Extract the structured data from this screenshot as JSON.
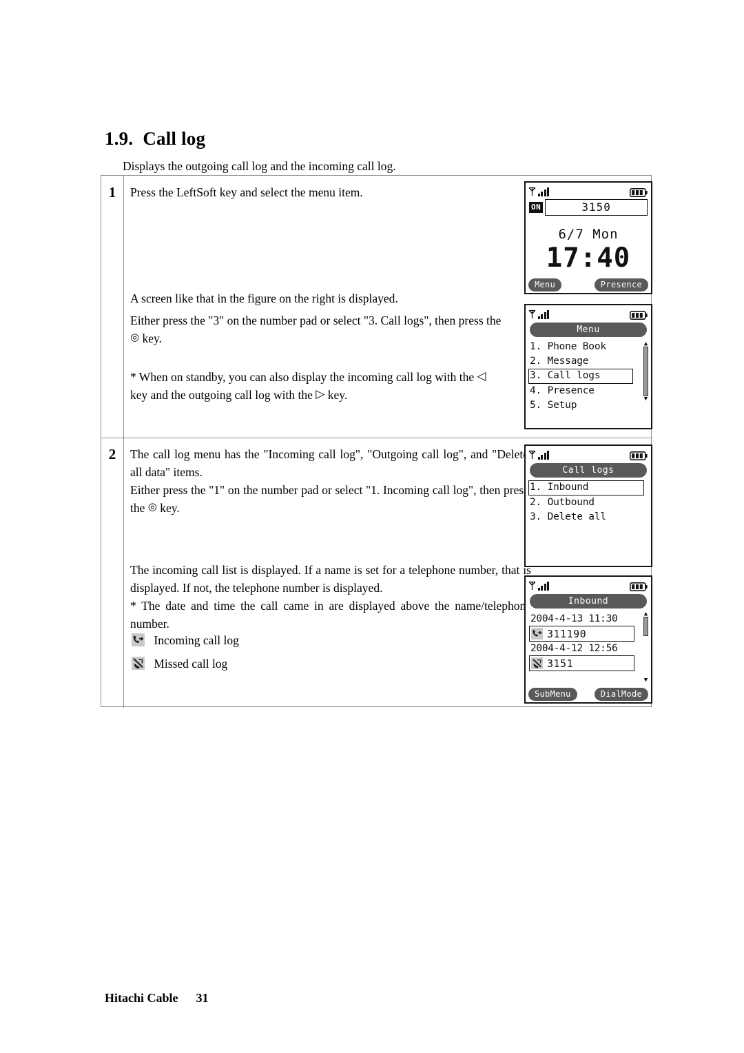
{
  "heading": {
    "number": "1.9.",
    "title": "Call log"
  },
  "intro": "Displays the outgoing call log and the incoming call log.",
  "steps": [
    {
      "number": "1",
      "paragraphs": [
        "Press the LeftSoft key and select the menu item.",
        "A screen like that in the figure on the right is displayed.",
        "Either press the \"3\" on the number pad or select \"3. Call logs\", then press the",
        "key.",
        "* When on standby, you can also display the incoming call log with the",
        "key and the outgoing call log with the",
        "key."
      ]
    },
    {
      "number": "2",
      "paragraphs": [
        "The call log menu has the \"Incoming call log\", \"Outgoing call log\", and \"Delete all data\" items.",
        "Either press the \"1\" on the number pad or select \"1. Incoming call log\", then press the",
        "key.",
        "The incoming call list is displayed. If a name is set for a telephone number, that is displayed.  If not, the telephone number is displayed.",
        "* The date and time the call came in are displayed above the name/telephone number."
      ],
      "legend": [
        {
          "icon": "incoming-call-icon",
          "label": "Incoming call log"
        },
        {
          "icon": "missed-call-icon",
          "label": "Missed call log"
        }
      ]
    }
  ],
  "key_glyphs": {
    "center": "◎",
    "left": "◁",
    "right": "▷"
  },
  "phones": {
    "standby": {
      "name": "standby-screen",
      "on_badge": "ON",
      "number": "3150",
      "date": "6/7 Mon",
      "time": "17:40",
      "softkey_left": "Menu",
      "softkey_right": "Presence"
    },
    "menu": {
      "name": "menu-screen",
      "title": "Menu",
      "items": [
        {
          "label": "1. Phone Book",
          "selected": false
        },
        {
          "label": "2. Message",
          "selected": false
        },
        {
          "label": "3. Call logs",
          "selected": true
        },
        {
          "label": "4. Presence",
          "selected": false
        },
        {
          "label": "5. Setup",
          "selected": false
        }
      ]
    },
    "call_logs": {
      "name": "call-logs-screen",
      "title": "Call logs",
      "items": [
        {
          "label": "1. Inbound",
          "selected": true
        },
        {
          "label": "2. Outbound",
          "selected": false
        },
        {
          "label": "3. Delete all",
          "selected": false
        }
      ]
    },
    "inbound": {
      "name": "inbound-screen",
      "title": "Inbound",
      "entries": [
        {
          "datetime": "2004-4-13  11:30",
          "icon": "incoming-call-icon",
          "number": "311190",
          "selected": true
        },
        {
          "datetime": "2004-4-12  12:56",
          "icon": "missed-call-icon",
          "number": "3151",
          "selected": false
        }
      ],
      "softkey_left": "SubMenu",
      "softkey_right": "DialMode"
    }
  },
  "footer": {
    "company": "Hitachi Cable",
    "page": "31"
  },
  "colors": {
    "rule": "#8e8e8e",
    "lcd_title_bg": "#595959",
    "ink": "#111111"
  }
}
